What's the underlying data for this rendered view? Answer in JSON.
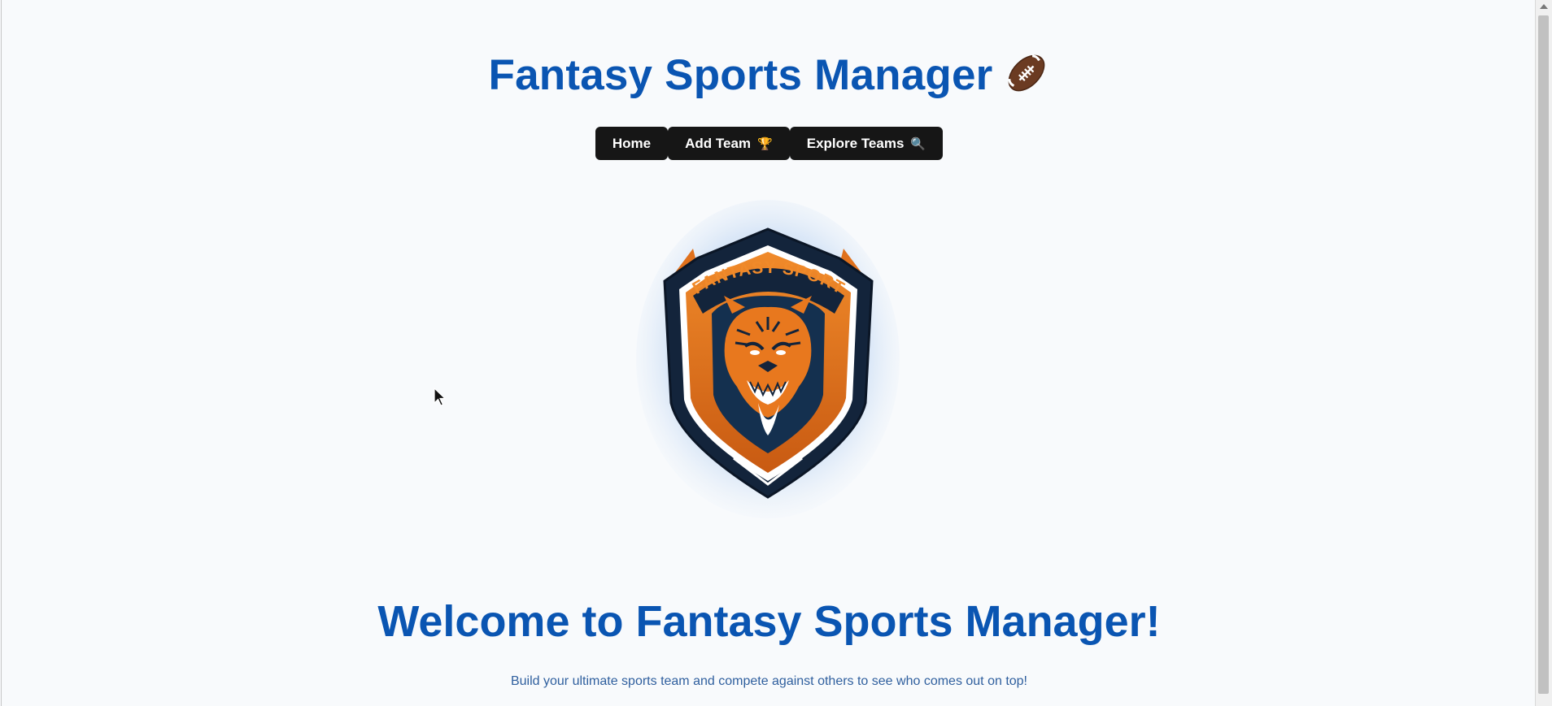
{
  "header": {
    "title": "Fantasy Sports Manager",
    "title_icon": "american-football-icon"
  },
  "nav": {
    "items": [
      {
        "label": "Home",
        "icon": null
      },
      {
        "label": "Add Team",
        "icon": "🏆"
      },
      {
        "label": "Explore Teams",
        "icon": "🔍"
      }
    ]
  },
  "logo": {
    "text": "FANTASY SPORT",
    "mascot": "tiger"
  },
  "hero": {
    "heading": "Welcome to Fantasy Sports Manager!",
    "subtitle": "Build your ultimate sports team and compete against others to see who comes out on top!"
  },
  "colors": {
    "brand_blue": "#0a55b2",
    "nav_bg": "#161616",
    "accent_orange": "#e0711c",
    "shield_navy": "#13243b"
  }
}
